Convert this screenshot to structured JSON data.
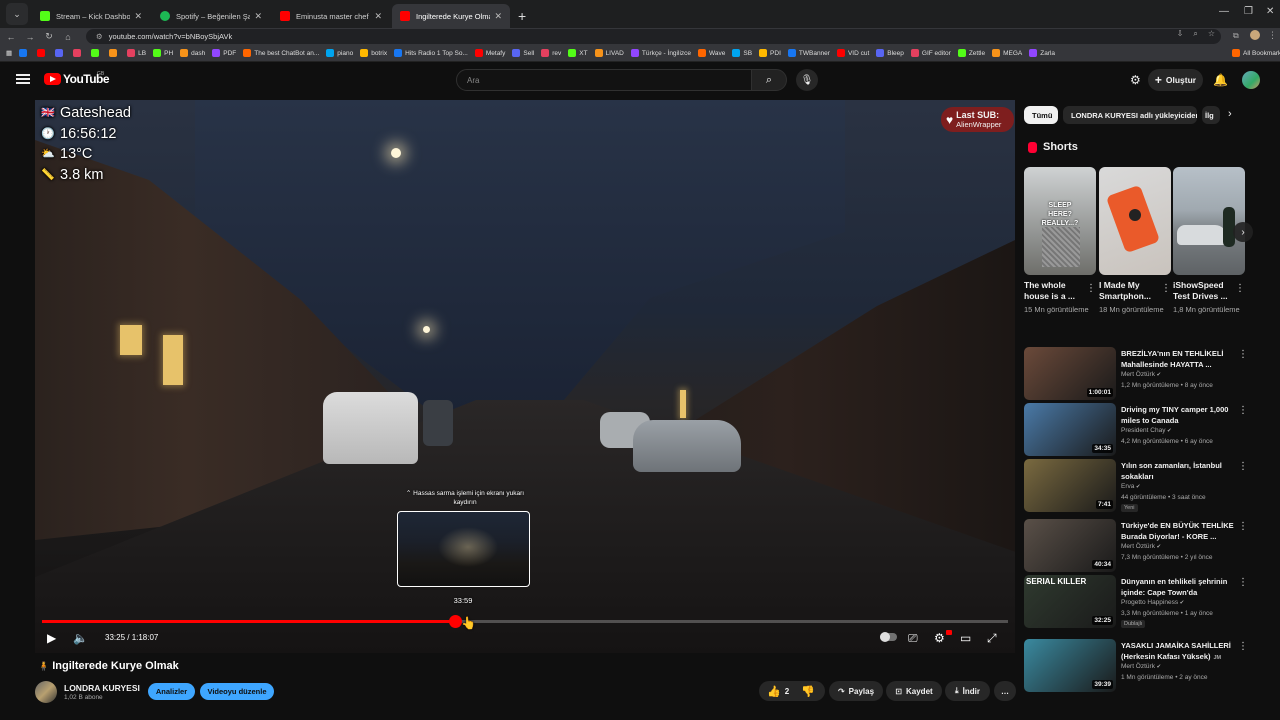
{
  "tabs": [
    {
      "title": "Stream – Kick Dashboard",
      "color": "#53fc18"
    },
    {
      "title": "Spotify – Beğenilen Şarkılar",
      "color": "#1db954"
    },
    {
      "title": "Eminusta master chef - YouTub",
      "color": "#ff0000"
    },
    {
      "title": "Ingilterede Kurye Olmak - Yo",
      "color": "#ff0000"
    }
  ],
  "address": {
    "url": "youtube.com/watch?v=bNBoySbjAVk"
  },
  "bookmarks": [
    "LB",
    "PH",
    "dash",
    "PDF",
    "The best ChatBot an...",
    "piano",
    "botrix",
    "Hits Radio 1 Top So...",
    "Metafy",
    "Sell",
    "rev",
    "XT",
    "LIVAD",
    "Türkçe - İngilizce",
    "Wave",
    "SB",
    "PDI",
    "TWBanner",
    "VID cut",
    "Bleep",
    "GIF editor",
    "Zettle",
    "MEGA",
    "Zarla",
    "All Bookmarks"
  ],
  "yt": {
    "logo": "YouTube",
    "country": "GB",
    "search_placeholder": "Ara",
    "create": "Oluştur"
  },
  "overlay": {
    "location": "Gateshead",
    "time": "16:56:12",
    "temp": "13°C",
    "distance": "3.8 km"
  },
  "last_sub": {
    "label": "Last SUB:",
    "name": "AlienWrapper"
  },
  "player": {
    "hint": "Hassas sarma işlemi için ekranı yukarı kaydırın",
    "preview_time": "33:59",
    "time_display": "33:25 / 1:18:07",
    "progress_fraction": 0.428
  },
  "video": {
    "title": "Ingilterede Kurye Olmak",
    "channel": "LONDRA KURYESI",
    "subs": "1,02 B abone",
    "analytics": "Analizler",
    "edit": "Videoyu düzenle",
    "likes": "2",
    "share": "Paylaş",
    "save": "Kaydet",
    "download": "İndir"
  },
  "chips": [
    "Tümü",
    "LONDRA KURYESI adlı yükleyiciden",
    "İlg"
  ],
  "shorts": {
    "heading": "Shorts",
    "items": [
      {
        "title": "The whole house is a ...",
        "views": "15 Mn görüntüleme",
        "overlay": "SLEEP HERE? REALLY...?"
      },
      {
        "title": "I Made My Smartphon...",
        "views": "18 Mn görüntüleme",
        "overlay": ""
      },
      {
        "title": "iShowSpeed Test Drives ...",
        "views": "1,8 Mn görüntüleme",
        "overlay": ""
      }
    ]
  },
  "recommended": [
    {
      "title": "BREZİLYA'nın EN TEHLİKELİ Mahallesinde HAYATTA ...",
      "channel": "Mert Öztürk",
      "meta": "1,2 Mn görüntüleme • 8 ay önce",
      "duration": "1:00:01",
      "badge": "",
      "thumb": "#6b4a3a"
    },
    {
      "title": "Driving my TINY camper 1,000 miles to Canada",
      "channel": "President Chay",
      "meta": "4,2 Mn görüntüleme • 6 ay önce",
      "duration": "34:35",
      "badge": "",
      "thumb": "#4a7aa8"
    },
    {
      "title": "Yılın son zamanları, İstanbul sokakları",
      "channel": "Erva",
      "meta": "44 görüntüleme • 3 saat önce",
      "duration": "7:41",
      "badge": "Yeni",
      "thumb": "#7a6a40"
    },
    {
      "title": "Türkiye'de EN BÜYÜK TEHLİKE Burada Diyorlar! - KORE ...",
      "channel": "Mert Öztürk",
      "meta": "7,3 Mn görüntüleme • 2 yıl önce",
      "duration": "40:34",
      "badge": "",
      "thumb": "#5a5048"
    },
    {
      "title": "Dünyanın en tehlikeli şehrinin içinde: Cape Town'da yaşamak...",
      "channel": "Progetto Happiness",
      "meta": "3,3 Mn görüntüleme • 1 ay önce",
      "duration": "32:25",
      "badge": "Dublajlı",
      "thumb": "#2f3a2f",
      "thumb_text": "SERIAL KILLER"
    },
    {
      "title": "YASAKLI JAMAİKA SAHİLLERİ (Herkesin Kafası Yüksek)",
      "channel": "Mert Öztürk",
      "meta": "1 Mn görüntüleme • 2 ay önce",
      "duration": "39:39",
      "badge": "",
      "thumb": "#3a8aa0",
      "title_extra": "JM"
    }
  ]
}
